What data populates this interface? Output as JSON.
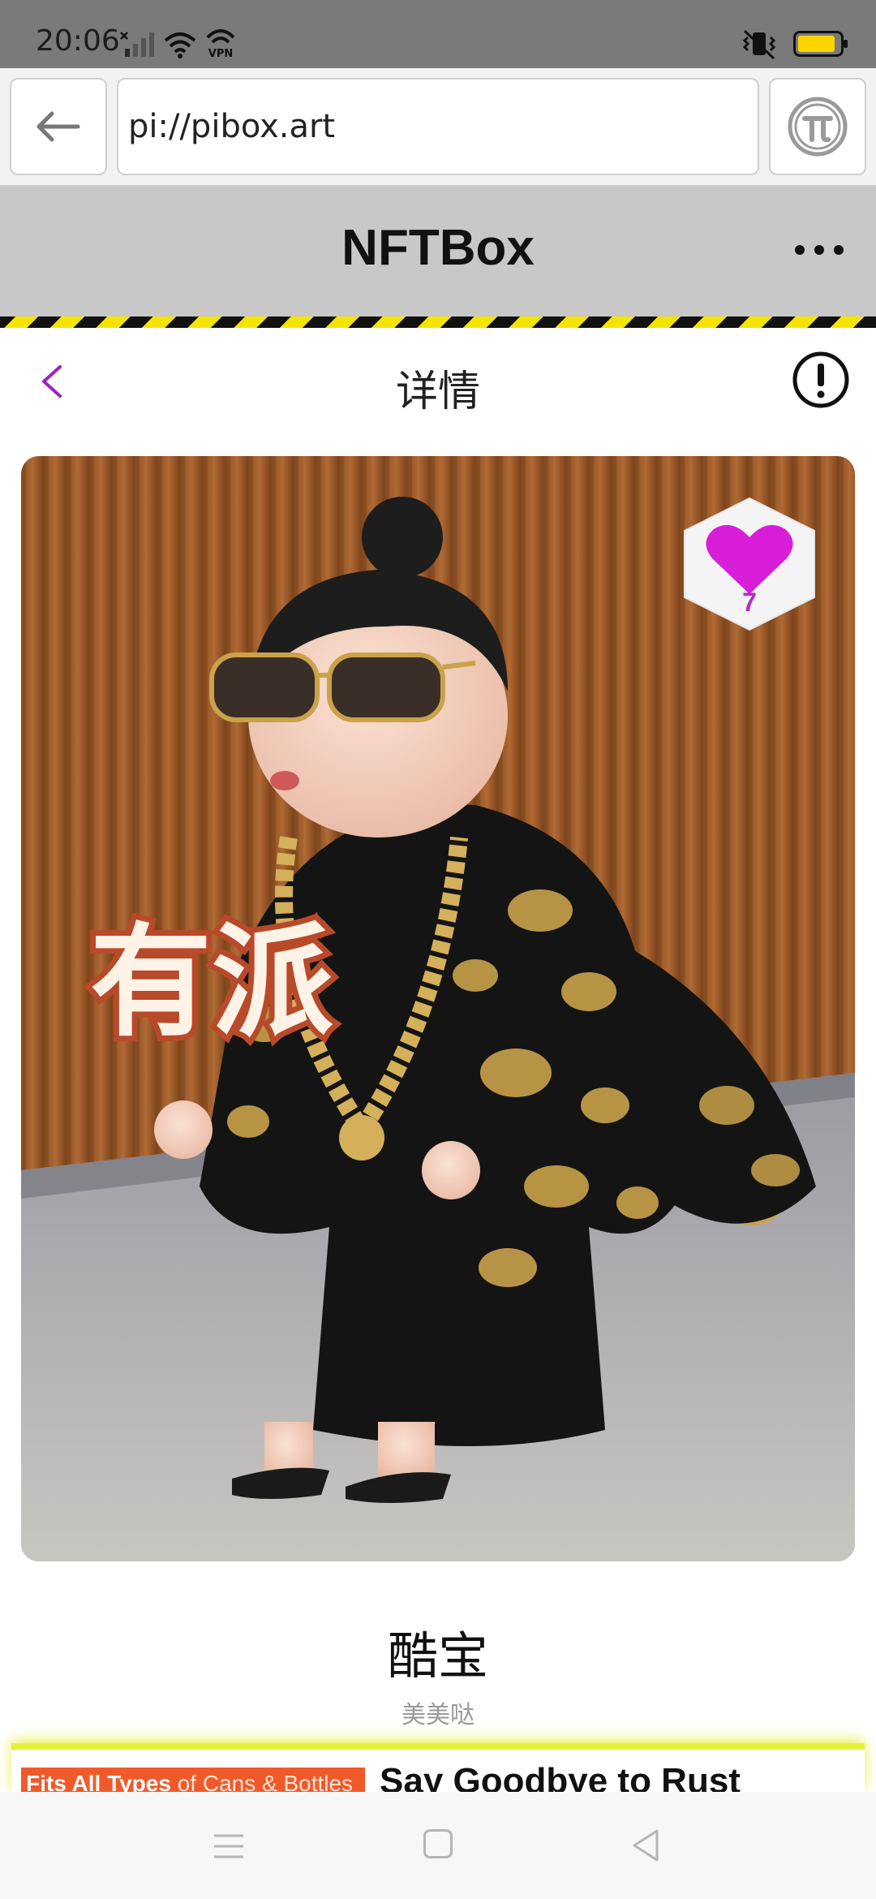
{
  "status_bar": {
    "time": "20:06",
    "vpn_label": "VPN",
    "battery_level_percent": 90,
    "icons": [
      "no-signal-icon",
      "wifi-icon",
      "vpn-icon",
      "vibrate-icon",
      "battery-icon"
    ]
  },
  "browser": {
    "url": "pi://pibox.art",
    "back_icon": "arrow-left-icon",
    "pi_icon": "pi-logo-icon"
  },
  "app_header": {
    "title": "NFTBox",
    "more_icon": "more-dots-icon"
  },
  "page": {
    "title": "详情",
    "back_icon": "chevron-left-icon",
    "info_icon": "info-circle-icon"
  },
  "artwork": {
    "caption_overlay": "有派",
    "like_count": "7",
    "like_icon": "heart-icon"
  },
  "item": {
    "title": "酷宝",
    "author": "美美哒"
  },
  "ad": {
    "left_text_bold": "Fits All Types",
    "left_text_rest": " of Cans & Bottles",
    "right_text": "Say Goodbye to Rust"
  },
  "colors": {
    "accent_purple": "#a020c0",
    "heart_magenta": "#d81ed8",
    "header_gray": "#c8c8c8",
    "hazard_yellow": "#f5e400",
    "battery_yellow": "#ffd400"
  }
}
